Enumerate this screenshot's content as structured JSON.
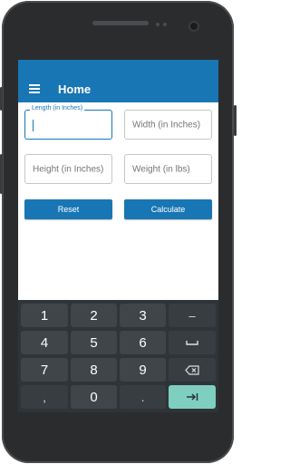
{
  "app": {
    "title": "Home"
  },
  "fields": {
    "length": {
      "label": "Length (in Inches)",
      "value": ""
    },
    "width": {
      "placeholder": "Width (in Inches)"
    },
    "height": {
      "placeholder": "Height (in Inches)"
    },
    "weight": {
      "placeholder": "Weight (in lbs)"
    }
  },
  "buttons": {
    "reset": "Reset",
    "calculate": "Calculate"
  },
  "keyboard": {
    "keys": [
      "1",
      "2",
      "3",
      "–",
      "4",
      "5",
      "6",
      "␣",
      "7",
      "8",
      "9",
      "backspace-icon",
      ",",
      "0",
      ".",
      "tab-next-icon"
    ]
  },
  "colors": {
    "accent": "#1976b4",
    "keyboard_bg": "#2e3438",
    "key_bg": "#3f4549",
    "enter_key": "#7fcfc0"
  }
}
